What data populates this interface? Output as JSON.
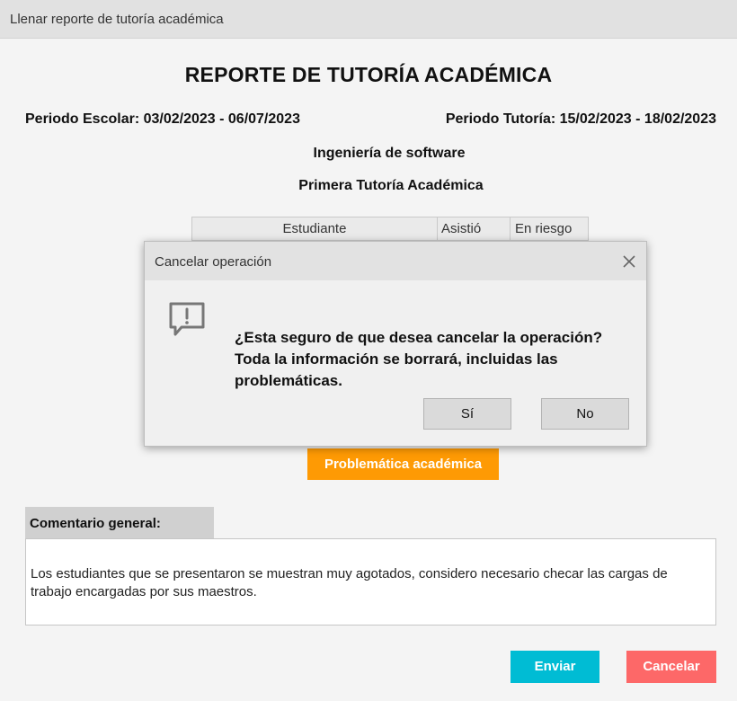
{
  "window": {
    "title": "Llenar reporte de tutoría académica"
  },
  "report": {
    "heading": "REPORTE DE TUTORÍA ACADÉMICA",
    "periodo_escolar": "Periodo Escolar: 03/02/2023 - 06/07/2023",
    "periodo_tutoria": "Periodo Tutoría: 15/02/2023 - 18/02/2023",
    "programa": "Ingeniería de software",
    "tutoria": "Primera Tutoría Académica"
  },
  "table": {
    "columns": [
      "Estudiante",
      "Asistió",
      "En riesgo"
    ]
  },
  "buttons": {
    "problematica": "Problemática académica",
    "enviar": "Enviar",
    "cancelar": "Cancelar"
  },
  "comment": {
    "label": "Comentario general:",
    "text": "Los estudiantes que se presentaron se muestran muy agotados, considero necesario checar las cargas de trabajo encargadas por sus maestros."
  },
  "dialog": {
    "title": "Cancelar operación",
    "message": "¿Esta seguro de que desea cancelar la operación? Toda la información se borrará, incluidas las problemáticas.",
    "yes_label": "Sí",
    "no_label": "No",
    "icon": "message-alert-icon"
  },
  "colors": {
    "problematica": "#fe9a04",
    "enviar": "#00bcd4",
    "cancelar": "#fd6868"
  }
}
